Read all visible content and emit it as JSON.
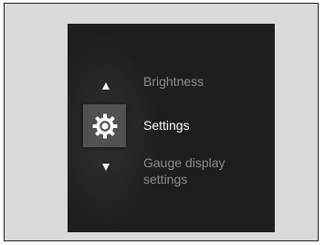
{
  "menu": {
    "previous_item": {
      "label": "Brightness"
    },
    "current_item": {
      "label": "Settings",
      "icon": "gear-icon"
    },
    "next_item": {
      "label_line1": "Gauge display",
      "label_line2": "settings"
    },
    "up_arrow_icon": "up-arrow-icon",
    "down_arrow_icon": "down-arrow-icon"
  },
  "colors": {
    "screen_background": "#201d1d",
    "frame_background": "#d9dada",
    "selected_text": "#ffffff",
    "unselected_text": "#8c8c8c",
    "icon_box": "#525151"
  }
}
